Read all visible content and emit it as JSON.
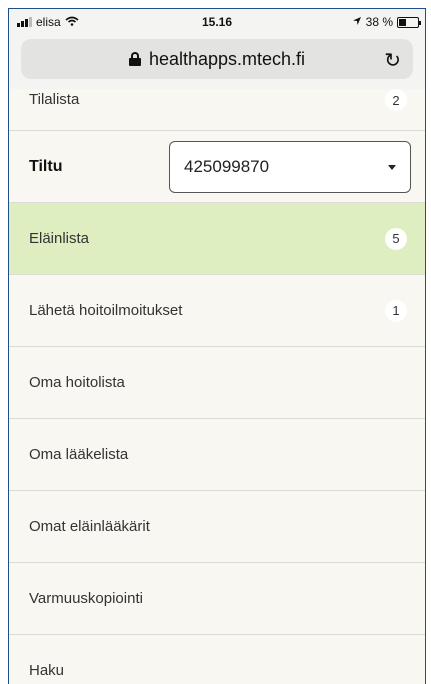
{
  "status_bar": {
    "carrier": "elisa",
    "time": "15.16",
    "battery": "38 %",
    "battery_level": 0.38
  },
  "browser": {
    "url": "healthapps.mtech.fi"
  },
  "menu": {
    "tilalista": {
      "label": "Tilalista",
      "badge": "2"
    },
    "tiltu": {
      "label": "Tiltu",
      "value": "425099870"
    },
    "items": [
      {
        "label": "Eläinlista",
        "badge": "5",
        "active": true
      },
      {
        "label": "Lähetä hoitoilmoitukset",
        "badge": "1"
      },
      {
        "label": "Oma hoitolista"
      },
      {
        "label": "Oma lääkelista"
      },
      {
        "label": "Omat eläinlääkärit"
      },
      {
        "label": "Varmuuskopiointi"
      },
      {
        "label": "Haku"
      }
    ]
  }
}
